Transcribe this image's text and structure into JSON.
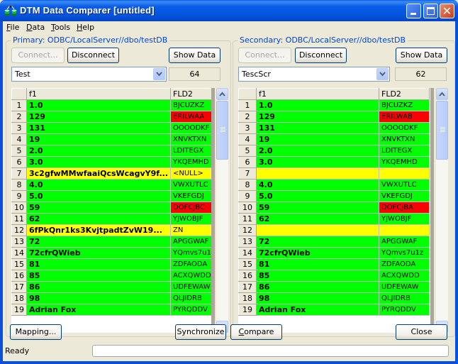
{
  "window": {
    "title": "DTM Data Comparer [untitled]",
    "app_icon": "database-compare-icon",
    "controls": [
      "minimize",
      "maximize",
      "close"
    ]
  },
  "menu": [
    {
      "label": "File",
      "accel": "F"
    },
    {
      "label": "Data",
      "accel": "D"
    },
    {
      "label": "Tools",
      "accel": "T"
    },
    {
      "label": "Help",
      "accel": "H"
    }
  ],
  "primary": {
    "legend": "Primary: ODBC/LocalServer//dbo/testDB",
    "connect_label": "Connect...",
    "disconnect_label": "Disconnect",
    "show_data_label": "Show Data",
    "table_selected": "Test",
    "row_count": "64",
    "columns": [
      "f1",
      "FLD2"
    ],
    "rows": [
      {
        "n": "1",
        "f1": "1.0",
        "fld2": "BJCUZKZ",
        "f1_status": "green",
        "fld2_status": "green"
      },
      {
        "n": "2",
        "f1": "129",
        "fld2": "ERILWAA",
        "f1_status": "green",
        "fld2_status": "red"
      },
      {
        "n": "3",
        "f1": "131",
        "fld2": "OOOODKF",
        "f1_status": "green",
        "fld2_status": "green"
      },
      {
        "n": "4",
        "f1": "19",
        "fld2": "XNVKTXN",
        "f1_status": "green",
        "fld2_status": "green"
      },
      {
        "n": "5",
        "f1": "2.0",
        "fld2": "LDITEGX",
        "f1_status": "green",
        "fld2_status": "green"
      },
      {
        "n": "6",
        "f1": "3.0",
        "fld2": "YKQEMHD",
        "f1_status": "green",
        "fld2_status": "green"
      },
      {
        "n": "7",
        "f1": "3c2gfwMMwfaaiQcsWcagvY9f...",
        "fld2": "<NULL>",
        "f1_status": "yellow",
        "fld2_status": "yellow"
      },
      {
        "n": "8",
        "f1": "4.0",
        "fld2": "VWXUTLC",
        "f1_status": "green",
        "fld2_status": "green"
      },
      {
        "n": "9",
        "f1": "5.0",
        "fld2": "VKEFGDJ",
        "f1_status": "green",
        "fld2_status": "green"
      },
      {
        "n": "10",
        "f1": "59",
        "fld2": "DOFCJBC",
        "f1_status": "green",
        "fld2_status": "red"
      },
      {
        "n": "11",
        "f1": "62",
        "fld2": "YJWOBJF",
        "f1_status": "green",
        "fld2_status": "green"
      },
      {
        "n": "12",
        "f1": "6fPkQnr1ks3KvjtpadtZvW19...",
        "fld2": "ZN",
        "f1_status": "yellow",
        "fld2_status": "yellow"
      },
      {
        "n": "13",
        "f1": "72",
        "fld2": "APGGWAF",
        "f1_status": "green",
        "fld2_status": "green"
      },
      {
        "n": "14",
        "f1": "72cfrQWieb",
        "fld2": "YQmvs7u1z",
        "f1_status": "green",
        "fld2_status": "green"
      },
      {
        "n": "15",
        "f1": "81",
        "fld2": "ZDFAODA",
        "f1_status": "green",
        "fld2_status": "green"
      },
      {
        "n": "16",
        "f1": "85",
        "fld2": "ACXQWDD",
        "f1_status": "green",
        "fld2_status": "green"
      },
      {
        "n": "17",
        "f1": "86",
        "fld2": "UDFEWAW",
        "f1_status": "green",
        "fld2_status": "green"
      },
      {
        "n": "18",
        "f1": "98",
        "fld2": "QLJIDRB",
        "f1_status": "green",
        "fld2_status": "green"
      },
      {
        "n": "19",
        "f1": "Adrian Fox",
        "fld2": "PYRQDDV",
        "f1_status": "green",
        "fld2_status": "green"
      }
    ]
  },
  "secondary": {
    "legend": "Secondary: ODBC/LocalServer//dbo/testDB",
    "connect_label": "Connect...",
    "disconnect_label": "Disconnect",
    "show_data_label": "Show Data",
    "table_selected": "TescScr",
    "row_count": "62",
    "columns": [
      "f1",
      "FLD2"
    ],
    "rows": [
      {
        "n": "1",
        "f1": "1.0",
        "fld2": "BJCUZKZ",
        "f1_status": "green",
        "fld2_status": "green"
      },
      {
        "n": "2",
        "f1": "129",
        "fld2": "ERILWAB",
        "f1_status": "green",
        "fld2_status": "red"
      },
      {
        "n": "3",
        "f1": "131",
        "fld2": "OOOODKF",
        "f1_status": "green",
        "fld2_status": "green"
      },
      {
        "n": "4",
        "f1": "19",
        "fld2": "XNVKTXN",
        "f1_status": "green",
        "fld2_status": "green"
      },
      {
        "n": "5",
        "f1": "2.0",
        "fld2": "LDITEGX",
        "f1_status": "green",
        "fld2_status": "green"
      },
      {
        "n": "6",
        "f1": "3.0",
        "fld2": "YKQEMHD",
        "f1_status": "green",
        "fld2_status": "green"
      },
      {
        "n": "7",
        "f1": "",
        "fld2": "",
        "f1_status": "yellow",
        "fld2_status": "yellow"
      },
      {
        "n": "8",
        "f1": "4.0",
        "fld2": "VWXUTLC",
        "f1_status": "green",
        "fld2_status": "green"
      },
      {
        "n": "9",
        "f1": "5.0",
        "fld2": "VKEFGDJ",
        "f1_status": "green",
        "fld2_status": "green"
      },
      {
        "n": "10",
        "f1": "59",
        "fld2": "DOFCJBA",
        "f1_status": "green",
        "fld2_status": "red"
      },
      {
        "n": "11",
        "f1": "62",
        "fld2": "YJWOBJF",
        "f1_status": "green",
        "fld2_status": "green"
      },
      {
        "n": "12",
        "f1": "",
        "fld2": "",
        "f1_status": "yellow",
        "fld2_status": "yellow"
      },
      {
        "n": "13",
        "f1": "72",
        "fld2": "APGGWAF",
        "f1_status": "green",
        "fld2_status": "green"
      },
      {
        "n": "14",
        "f1": "72cfrQWieb",
        "fld2": "YQmvs7u1z",
        "f1_status": "green",
        "fld2_status": "green"
      },
      {
        "n": "15",
        "f1": "81",
        "fld2": "ZDFAODA",
        "f1_status": "green",
        "fld2_status": "green"
      },
      {
        "n": "16",
        "f1": "85",
        "fld2": "ACXQWDD",
        "f1_status": "green",
        "fld2_status": "green"
      },
      {
        "n": "17",
        "f1": "86",
        "fld2": "UDFEWAW",
        "f1_status": "green",
        "fld2_status": "green"
      },
      {
        "n": "18",
        "f1": "98",
        "fld2": "QLJIDRB",
        "f1_status": "green",
        "fld2_status": "green"
      },
      {
        "n": "19",
        "f1": "Adrian Fox",
        "fld2": "PYRQDDV",
        "f1_status": "green",
        "fld2_status": "green"
      }
    ]
  },
  "status_colors": {
    "green": "#00ff00",
    "red": "#ff0000",
    "yellow": "#ffff00"
  },
  "bottom": {
    "mapping_label": "Mapping...",
    "synchronize_label": "Synchronize",
    "compare_label": "Compare",
    "compare_accel": "C",
    "close_label": "Close"
  },
  "status": {
    "text": "Ready",
    "progress": 0
  }
}
